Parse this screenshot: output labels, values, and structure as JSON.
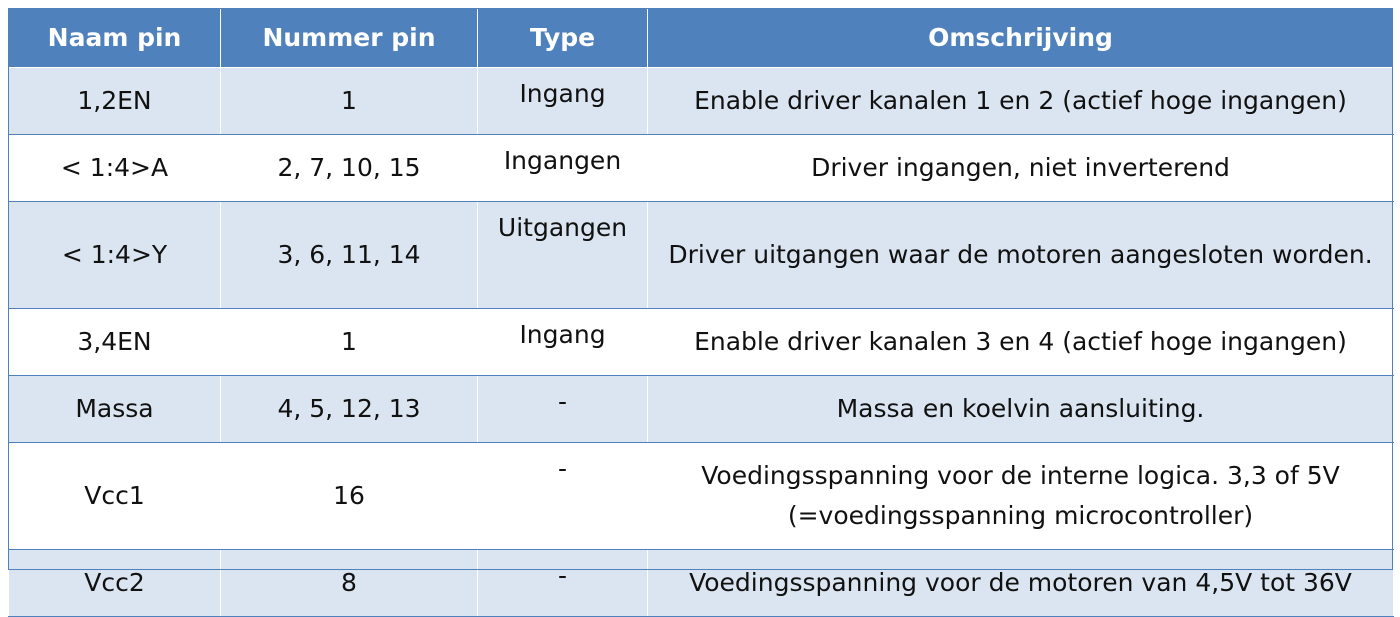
{
  "table": {
    "headers": [
      "Naam pin",
      "Nummer pin",
      "Type",
      "Omschrijving"
    ],
    "rows": [
      {
        "naam": "1,2EN",
        "nummer": "1",
        "type": "Ingang",
        "omschrijving": "Enable driver kanalen 1 en 2 (actief hoge ingangen)"
      },
      {
        "naam": "< 1:4>A",
        "nummer": "2, 7, 10, 15",
        "type": "Ingangen",
        "omschrijving": "Driver ingangen, niet inverterend"
      },
      {
        "naam": "< 1:4>Y",
        "nummer": "3, 6, 11, 14",
        "type": "Uitgangen",
        "omschrijving": "Driver uitgangen waar de motoren aangesloten worden."
      },
      {
        "naam": "3,4EN",
        "nummer": "1",
        "type": "Ingang",
        "omschrijving": "Enable driver kanalen 3 en 4 (actief hoge ingangen)"
      },
      {
        "naam": "Massa",
        "nummer": "4, 5, 12, 13",
        "type": "-",
        "omschrijving": "Massa en koelvin aansluiting."
      },
      {
        "naam": "Vcc1",
        "nummer": "16",
        "type": "-",
        "omschrijving": "Voedingsspanning voor de interne logica. 3,3 of 5V (=voedingsspanning microcontroller)"
      },
      {
        "naam": "Vcc2",
        "nummer": "8",
        "type": "-",
        "omschrijving": "Voedingsspanning voor de motoren van 4,5V tot 36V"
      }
    ]
  },
  "colors": {
    "header_bg": "#4f81bd",
    "band_bg": "#dbe5f1",
    "header_text": "#ffffff"
  }
}
